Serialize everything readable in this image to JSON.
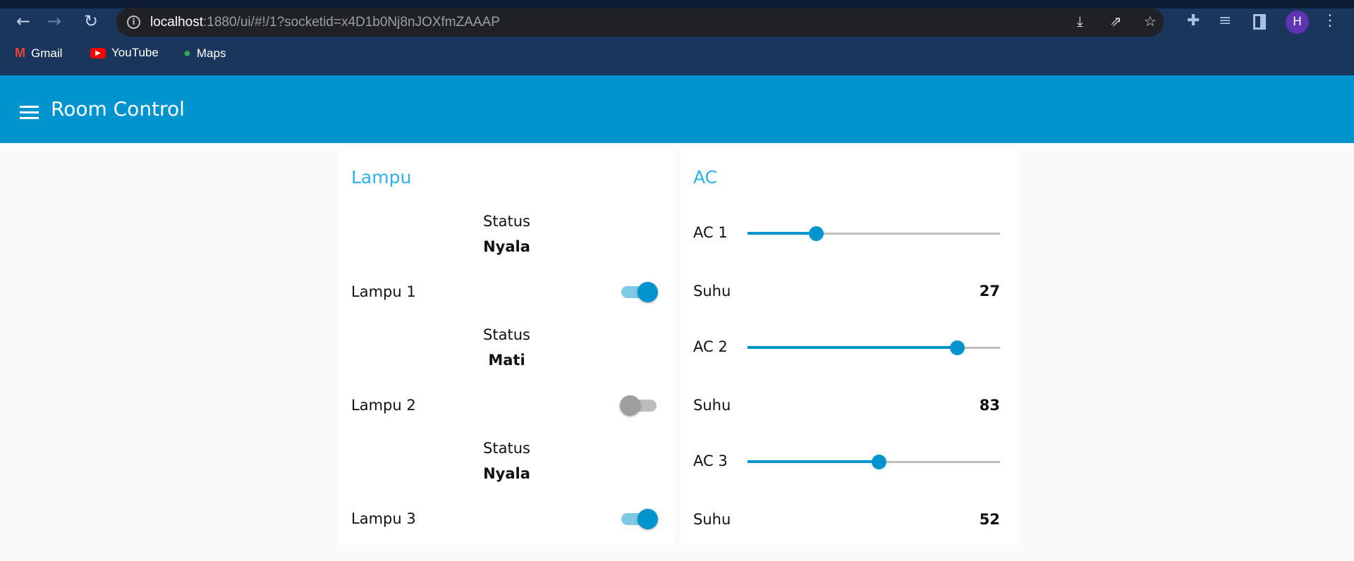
{
  "browser": {
    "url_host": "localhost",
    "url_rest": ":1880/ui/#!/1?socketid=x4D1b0Nj8nJOXfmZAAAP",
    "avatar_letter": "H",
    "bookmarks": [
      {
        "label": "Gmail",
        "icon": "gmail-icon"
      },
      {
        "label": "YouTube",
        "icon": "youtube-icon"
      },
      {
        "label": "Maps",
        "icon": "maps-icon"
      }
    ]
  },
  "app": {
    "title": "Room Control",
    "accent": "#0094ce"
  },
  "lampu": {
    "title": "Lampu",
    "items": [
      {
        "status_label": "Status",
        "status": "Nyala",
        "label": "Lampu 1",
        "on": true
      },
      {
        "status_label": "Status",
        "status": "Mati",
        "label": "Lampu 2",
        "on": false
      },
      {
        "status_label": "Status",
        "status": "Nyala",
        "label": "Lampu 3",
        "on": true
      }
    ]
  },
  "ac": {
    "title": "AC",
    "items": [
      {
        "label": "AC 1",
        "value": 27,
        "temp_label": "Suhu",
        "temp": "27"
      },
      {
        "label": "AC 2",
        "value": 83,
        "temp_label": "Suhu",
        "temp": "83"
      },
      {
        "label": "AC 3",
        "value": 52,
        "temp_label": "Suhu",
        "temp": "52"
      }
    ],
    "slider_range": [
      0,
      100
    ]
  }
}
